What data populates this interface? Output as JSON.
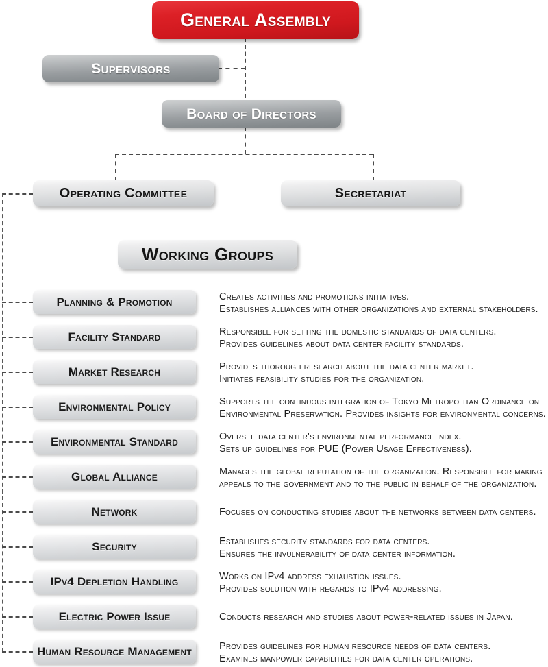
{
  "diagram": {
    "title": "General Assembly Organizational Chart",
    "colors": {
      "accent_red": "#DC2026",
      "node_dark_grey": "#9A9EA1",
      "node_light_grey": "#E2E3E4",
      "connector": "#4A4A4A",
      "text_light": "#FFFFFF",
      "text_dark": "#151515",
      "background": "#FFFFFF"
    },
    "top": {
      "general_assembly": "General Assembly",
      "supervisors": "Supervisors",
      "board_of_directors": "Board of Directors",
      "operating_committee": "Operating Committee",
      "secretariat": "Secretariat"
    },
    "working_groups_banner": "Working Groups",
    "working_groups": [
      {
        "name": "Planning & Promotion",
        "description_lines": [
          "Creates activities and promotions initiatives.",
          "Establishes alliances with other organizations and external stakeholders."
        ]
      },
      {
        "name": "Facility Standard",
        "description_lines": [
          "Responsible for setting the domestic standards of data centers.",
          "Provides guidelines about data center facility standards."
        ]
      },
      {
        "name": "Market Research",
        "description_lines": [
          "Provides thorough research about the data center market.",
          "Initiates feasibility studies for the organization."
        ]
      },
      {
        "name": "Environmental Policy",
        "description_lines": [
          "Supports the continuous integration of Tokyo Metropolitan Ordinance on",
          "Environmental Preservation. Provides insights for environmental concerns."
        ]
      },
      {
        "name": "Environmental Standard",
        "description_lines": [
          "Oversee data center's environmental performance index.",
          "Sets up guidelines for PUE (Power Usage Effectiveness)."
        ]
      },
      {
        "name": "Global Alliance",
        "description_lines": [
          "Manages the global reputation of the organization. Responsible for making",
          "appeals to the government and to the public in behalf of the organization."
        ]
      },
      {
        "name": "Network",
        "description_lines": [
          "Focuses on conducting studies about the networks between data centers."
        ]
      },
      {
        "name": "Security",
        "description_lines": [
          "Establishes security standards for data centers.",
          "Ensures the invulnerability of data center information."
        ]
      },
      {
        "name": "IPv4 Depletion Handling",
        "description_lines": [
          "Works on IPv4 address exhaustion issues.",
          "Provides solution with regards to IPv4 addressing."
        ]
      },
      {
        "name": "Electric Power Issue",
        "description_lines": [
          "Conducts research and studies about power-related issues in Japan."
        ]
      },
      {
        "name": "Human Resource Management",
        "description_lines": [
          "Provides guidelines for human resource needs of data centers.",
          "Examines manpower capabilities for data center operations."
        ]
      }
    ]
  }
}
